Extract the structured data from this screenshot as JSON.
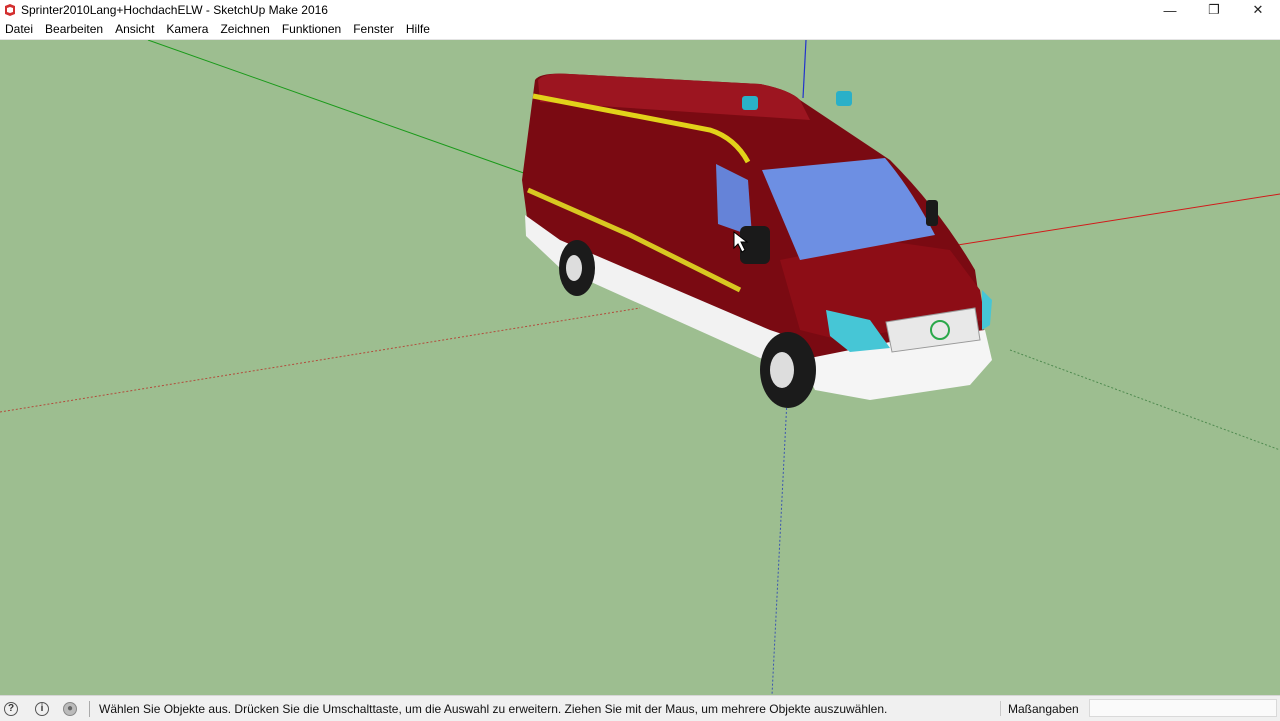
{
  "window": {
    "title": "Sprinter2010Lang+HochdachELW - SketchUp Make 2016",
    "controls": {
      "minimize": "—",
      "restore": "❐",
      "close": "✕"
    }
  },
  "menu": {
    "items": [
      "Datei",
      "Bearbeiten",
      "Ansicht",
      "Kamera",
      "Zeichnen",
      "Funktionen",
      "Fenster",
      "Hilfe"
    ]
  },
  "viewport": {
    "background": "#9dbe90",
    "model": "fire-department-van",
    "axes": {
      "red": "#d11a1a",
      "green": "#1a9a1a",
      "blue": "#2233cc"
    }
  },
  "statusbar": {
    "icons": [
      "question-icon",
      "info-icon",
      "user-icon"
    ],
    "message": "Wählen Sie Objekte aus. Drücken Sie die Umschalttaste, um die Auswahl zu erweitern. Ziehen Sie mit der Maus, um mehrere Objekte auszuwählen.",
    "measurements_label": "Maßangaben",
    "measurements_value": ""
  }
}
